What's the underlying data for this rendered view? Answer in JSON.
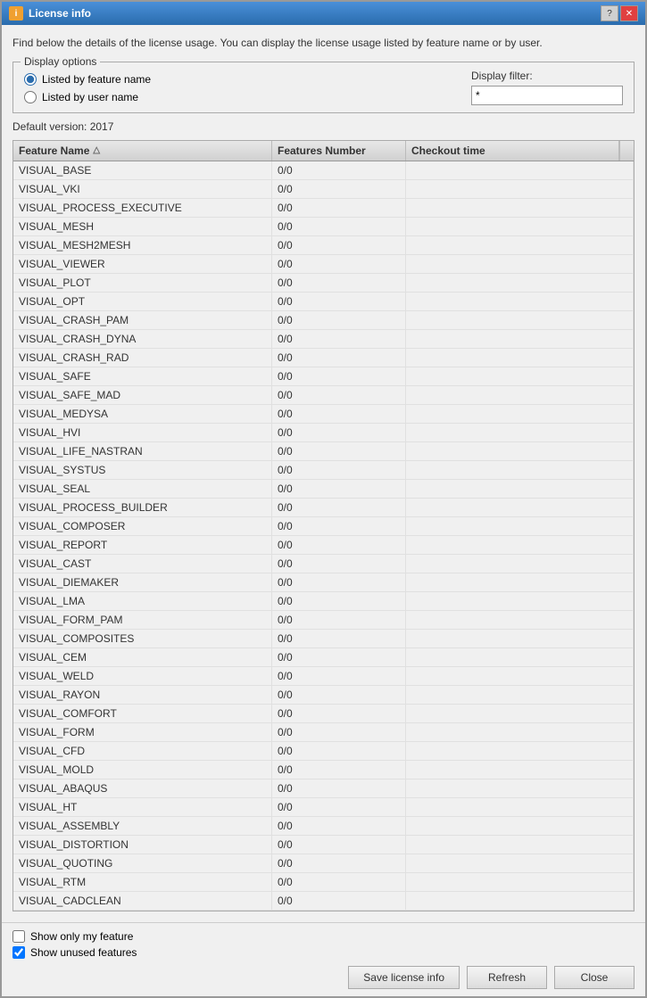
{
  "window": {
    "title": "License info",
    "icon": "i"
  },
  "description": "Find below the details of the license usage. You can display the license usage listed by feature name or by user.",
  "display_options": {
    "legend": "Display options",
    "radio_feature": "Listed by feature name",
    "radio_user": "Listed by user name",
    "radio_feature_checked": true,
    "filter_label": "Display filter:",
    "filter_value": "*"
  },
  "default_version": "Default version: 2017",
  "table": {
    "columns": [
      {
        "key": "feature",
        "label": "Feature Name"
      },
      {
        "key": "number",
        "label": "Features Number"
      },
      {
        "key": "checkout",
        "label": "Checkout time"
      }
    ],
    "rows": [
      {
        "feature": "VISUAL_BASE",
        "number": "0/0",
        "checkout": ""
      },
      {
        "feature": "VISUAL_VKI",
        "number": "0/0",
        "checkout": ""
      },
      {
        "feature": "VISUAL_PROCESS_EXECUTIVE",
        "number": "0/0",
        "checkout": ""
      },
      {
        "feature": "VISUAL_MESH",
        "number": "0/0",
        "checkout": ""
      },
      {
        "feature": "VISUAL_MESH2MESH",
        "number": "0/0",
        "checkout": ""
      },
      {
        "feature": "VISUAL_VIEWER",
        "number": "0/0",
        "checkout": ""
      },
      {
        "feature": "VISUAL_PLOT",
        "number": "0/0",
        "checkout": ""
      },
      {
        "feature": "VISUAL_OPT",
        "number": "0/0",
        "checkout": ""
      },
      {
        "feature": "VISUAL_CRASH_PAM",
        "number": "0/0",
        "checkout": ""
      },
      {
        "feature": "VISUAL_CRASH_DYNA",
        "number": "0/0",
        "checkout": ""
      },
      {
        "feature": "VISUAL_CRASH_RAD",
        "number": "0/0",
        "checkout": ""
      },
      {
        "feature": "VISUAL_SAFE",
        "number": "0/0",
        "checkout": ""
      },
      {
        "feature": "VISUAL_SAFE_MAD",
        "number": "0/0",
        "checkout": ""
      },
      {
        "feature": "VISUAL_MEDYSA",
        "number": "0/0",
        "checkout": ""
      },
      {
        "feature": "VISUAL_HVI",
        "number": "0/0",
        "checkout": ""
      },
      {
        "feature": "VISUAL_LIFE_NASTRAN",
        "number": "0/0",
        "checkout": ""
      },
      {
        "feature": "VISUAL_SYSTUS",
        "number": "0/0",
        "checkout": ""
      },
      {
        "feature": "VISUAL_SEAL",
        "number": "0/0",
        "checkout": ""
      },
      {
        "feature": "VISUAL_PROCESS_BUILDER",
        "number": "0/0",
        "checkout": ""
      },
      {
        "feature": "VISUAL_COMPOSER",
        "number": "0/0",
        "checkout": ""
      },
      {
        "feature": "VISUAL_REPORT",
        "number": "0/0",
        "checkout": ""
      },
      {
        "feature": "VISUAL_CAST",
        "number": "0/0",
        "checkout": ""
      },
      {
        "feature": "VISUAL_DIEMAKER",
        "number": "0/0",
        "checkout": ""
      },
      {
        "feature": "VISUAL_LMA",
        "number": "0/0",
        "checkout": ""
      },
      {
        "feature": "VISUAL_FORM_PAM",
        "number": "0/0",
        "checkout": ""
      },
      {
        "feature": "VISUAL_COMPOSITES",
        "number": "0/0",
        "checkout": ""
      },
      {
        "feature": "VISUAL_CEM",
        "number": "0/0",
        "checkout": ""
      },
      {
        "feature": "VISUAL_WELD",
        "number": "0/0",
        "checkout": ""
      },
      {
        "feature": "VISUAL_RAYON",
        "number": "0/0",
        "checkout": ""
      },
      {
        "feature": "VISUAL_COMFORT",
        "number": "0/0",
        "checkout": ""
      },
      {
        "feature": "VISUAL_FORM",
        "number": "0/0",
        "checkout": ""
      },
      {
        "feature": "VISUAL_CFD",
        "number": "0/0",
        "checkout": ""
      },
      {
        "feature": "VISUAL_MOLD",
        "number": "0/0",
        "checkout": ""
      },
      {
        "feature": "VISUAL_ABAQUS",
        "number": "0/0",
        "checkout": ""
      },
      {
        "feature": "VISUAL_HT",
        "number": "0/0",
        "checkout": ""
      },
      {
        "feature": "VISUAL_ASSEMBLY",
        "number": "0/0",
        "checkout": ""
      },
      {
        "feature": "VISUAL_DISTORTION",
        "number": "0/0",
        "checkout": ""
      },
      {
        "feature": "VISUAL_QUOTING",
        "number": "0/0",
        "checkout": ""
      },
      {
        "feature": "VISUAL_RTM",
        "number": "0/0",
        "checkout": ""
      },
      {
        "feature": "VISUAL_CADCLEAN",
        "number": "0/0",
        "checkout": ""
      }
    ]
  },
  "footer": {
    "checkbox_only_mine": "Show only my feature",
    "checkbox_unused": "Show unused features",
    "checkbox_unused_checked": true,
    "btn_save": "Save license info",
    "btn_refresh": "Refresh",
    "btn_close": "Close"
  }
}
